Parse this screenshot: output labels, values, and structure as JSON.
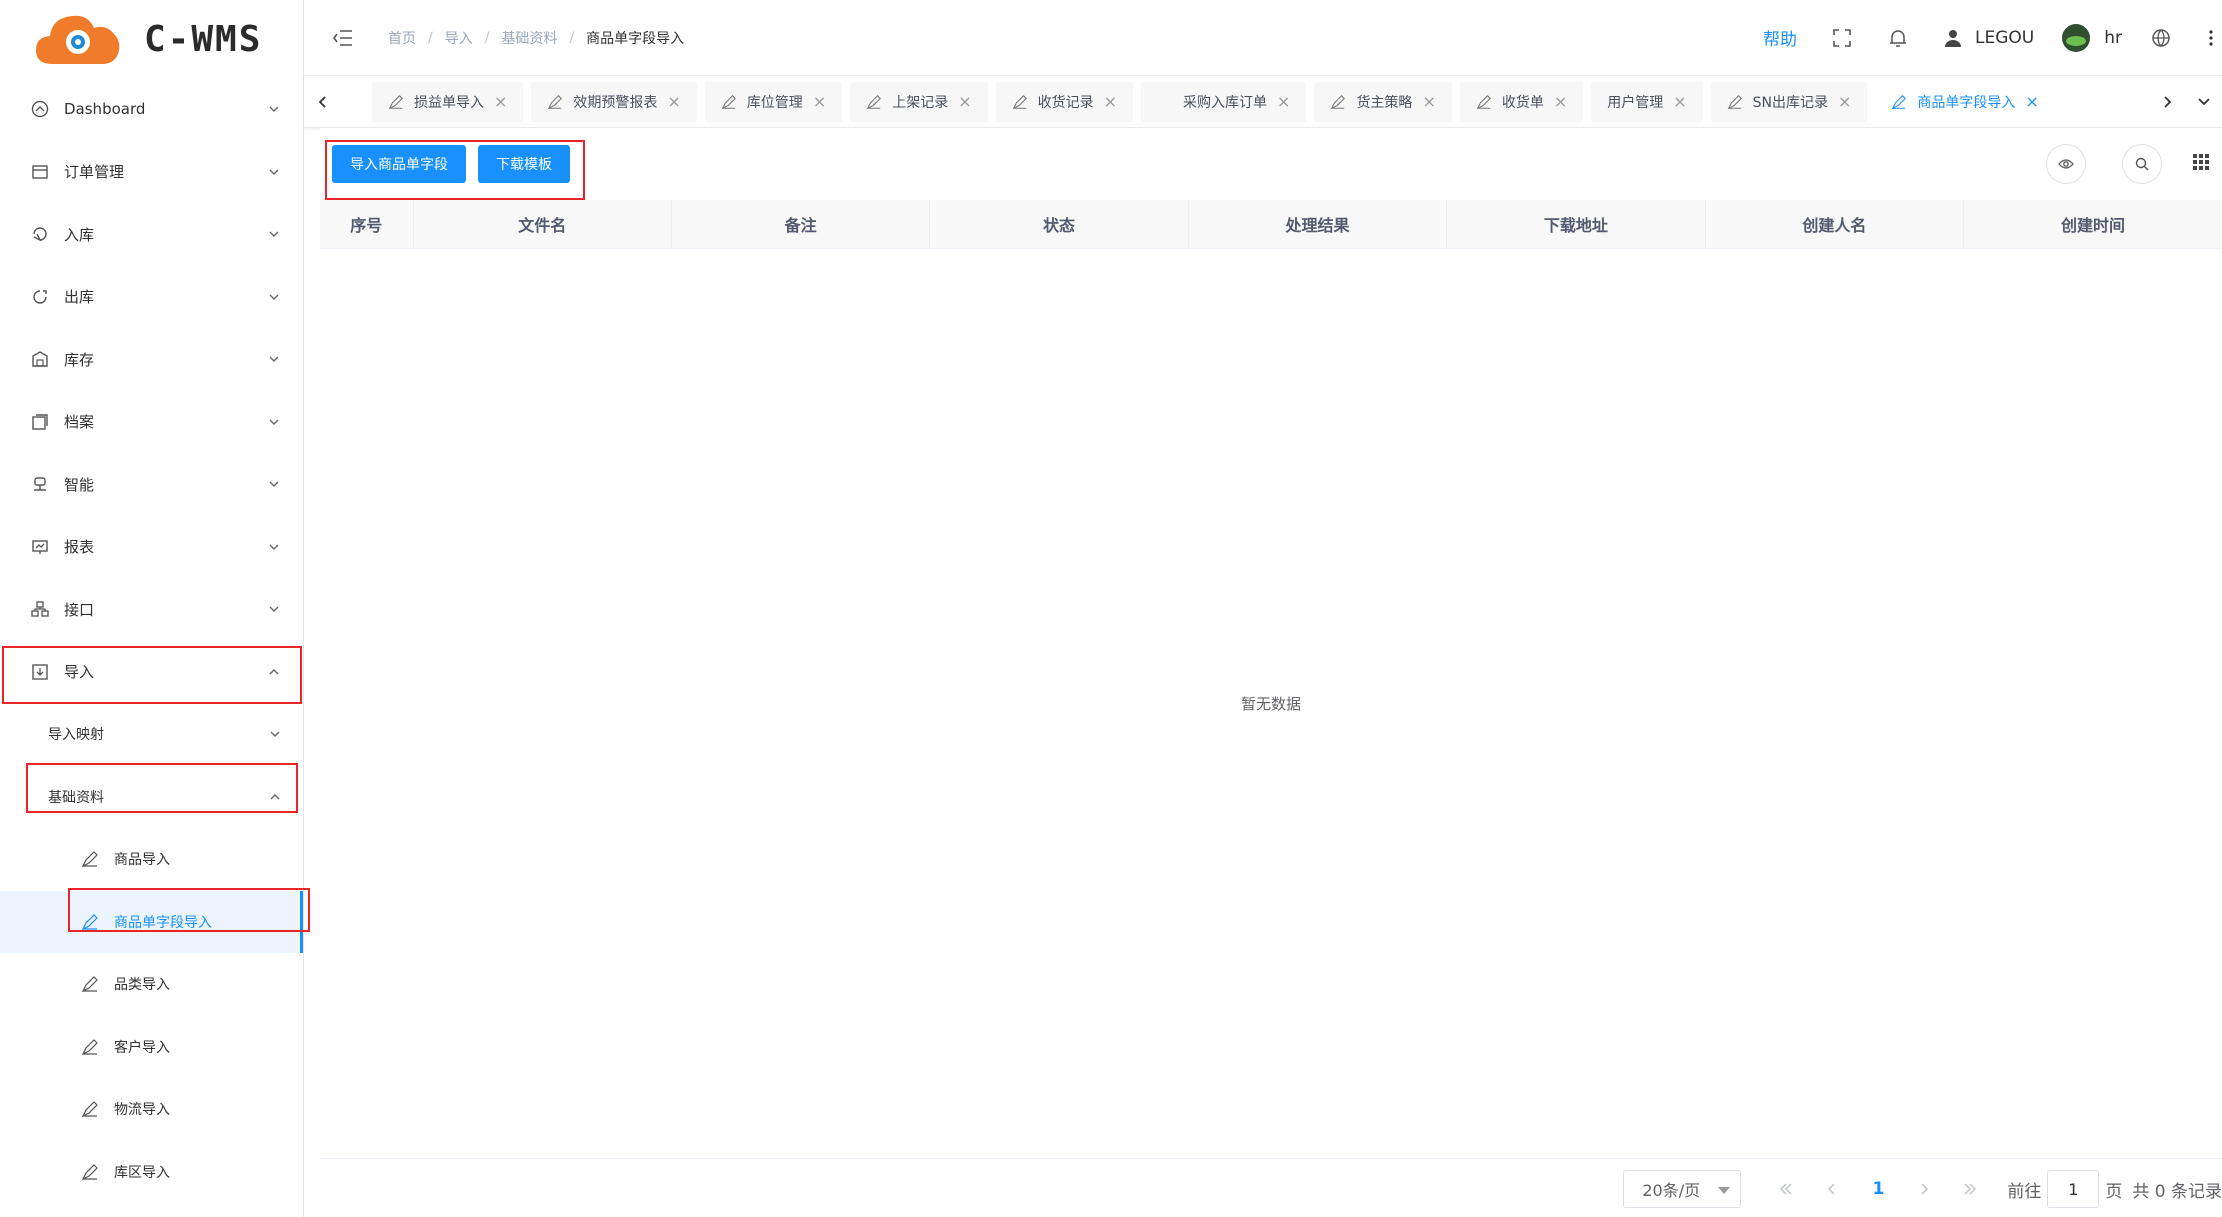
{
  "brand": {
    "logo_text": "C-WMS"
  },
  "sidebar": {
    "menu": [
      {
        "label": "Dashboard",
        "icon": "dashboard-icon"
      },
      {
        "label": "订单管理",
        "icon": "order-icon"
      },
      {
        "label": "入库",
        "icon": "inbound-icon"
      },
      {
        "label": "出库",
        "icon": "outbound-icon"
      },
      {
        "label": "库存",
        "icon": "inventory-icon"
      },
      {
        "label": "档案",
        "icon": "archive-icon"
      },
      {
        "label": "智能",
        "icon": "robot-icon"
      },
      {
        "label": "报表",
        "icon": "report-icon"
      },
      {
        "label": "接口",
        "icon": "api-icon"
      },
      {
        "label": "导入",
        "icon": "import-icon"
      }
    ],
    "import_sub": [
      {
        "label": "导入映射"
      },
      {
        "label": "基础资料"
      }
    ],
    "leaves": [
      {
        "label": "商品导入"
      },
      {
        "label": "商品单字段导入"
      },
      {
        "label": "品类导入"
      },
      {
        "label": "客户导入"
      },
      {
        "label": "物流导入"
      },
      {
        "label": "库区导入"
      }
    ]
  },
  "header": {
    "breadcrumb": [
      "首页",
      "导入",
      "基础资料",
      "商品单字段导入"
    ],
    "help": "帮助",
    "user_name": "LEGOU",
    "account": "hr"
  },
  "tabs": [
    {
      "label": "损益单导入"
    },
    {
      "label": "效期预警报表"
    },
    {
      "label": "库位管理"
    },
    {
      "label": "上架记录"
    },
    {
      "label": "收货记录"
    },
    {
      "label": "采购入库订单"
    },
    {
      "label": "货主策略"
    },
    {
      "label": "收货单"
    },
    {
      "label": "用户管理"
    },
    {
      "label": "SN出库记录"
    },
    {
      "label": "商品单字段导入"
    }
  ],
  "toolbar": {
    "import_btn": "导入商品单字段",
    "download_btn": "下载模板"
  },
  "table": {
    "columns": [
      "序号",
      "文件名",
      "备注",
      "状态",
      "处理结果",
      "下载地址",
      "创建人名",
      "创建时间"
    ],
    "empty_text": "暂无数据"
  },
  "pagination": {
    "page_size": "20条/页",
    "current": "1",
    "goto_label": "前往",
    "goto_value": "1",
    "page_unit": "页",
    "total_text": "共 0 条记录"
  },
  "colors": {
    "primary": "#1890ff",
    "highlight_box": "#e8262a"
  }
}
